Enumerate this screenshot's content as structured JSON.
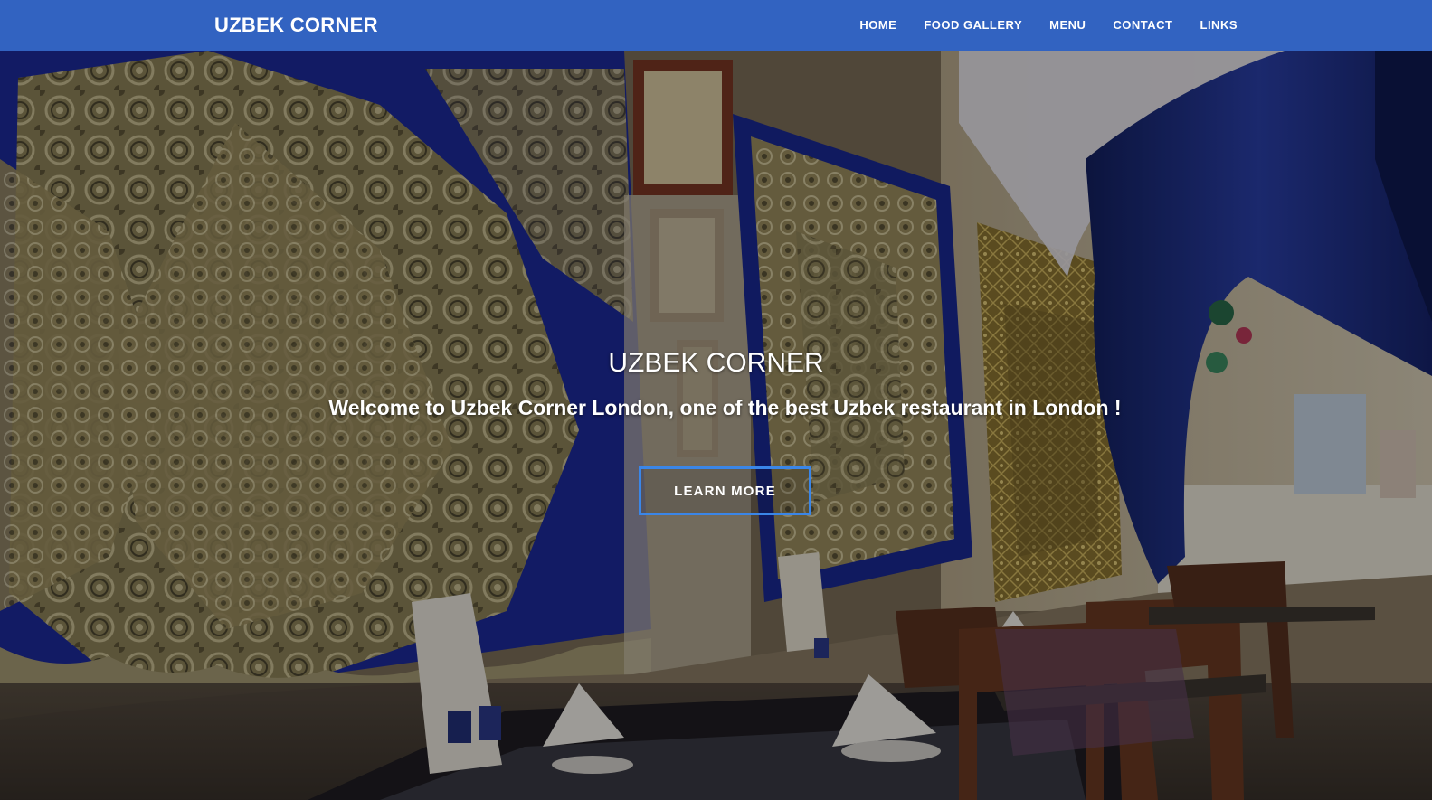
{
  "navbar": {
    "brand": "UZBEK CORNER",
    "links": [
      "HOME",
      "FOOD GALLERY",
      "MENU",
      "CONTACT",
      "LINKS"
    ]
  },
  "hero": {
    "title": "UZBEK CORNER",
    "subtitle": "Welcome to Uzbek Corner London, one of the best Uzbek restaurant in London !",
    "button_label": "LEARN MORE"
  },
  "colors": {
    "navbar_bg": "#3263c1",
    "button_border": "#3a86e8",
    "tapestry_blue": "#1d2a9a",
    "drape_blue": "#1e2f8c"
  }
}
